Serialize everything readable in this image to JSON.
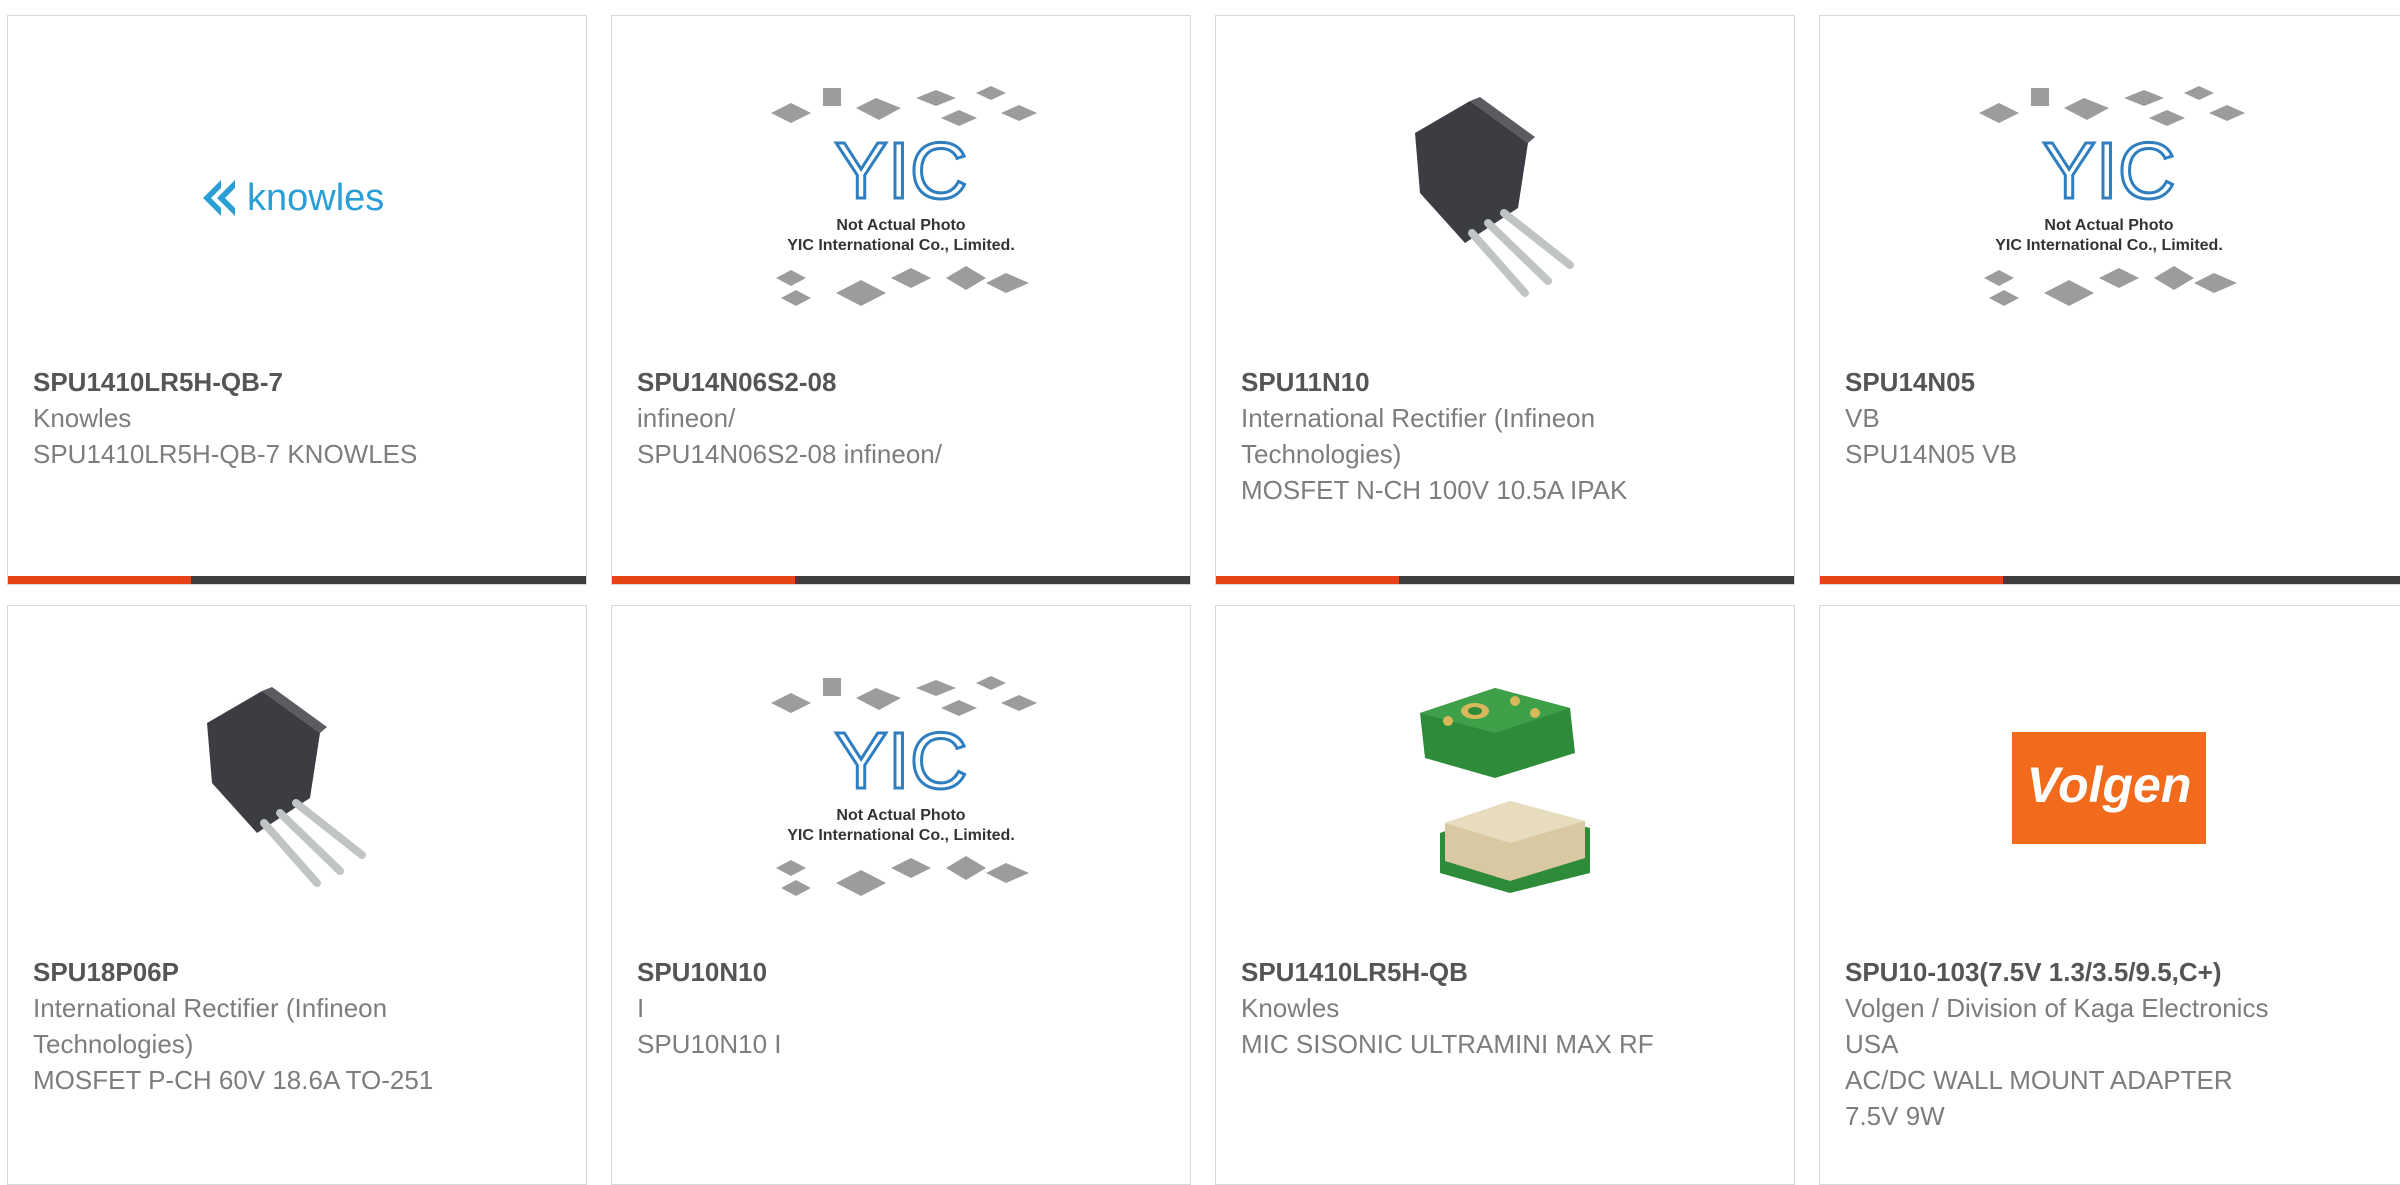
{
  "products": [
    {
      "part_number": "SPU1410LR5H-QB-7",
      "manufacturer": "Knowles",
      "description": "SPU1410LR5H-QB-7 KNOWLES",
      "image_icon": "knowles-logo",
      "logo_text": "knowles"
    },
    {
      "part_number": "SPU14N06S2-08",
      "manufacturer": "infineon/",
      "description": "SPU14N06S2-08 infineon/",
      "image_icon": "yic-placeholder",
      "placeholder_line1": "Not Actual Photo",
      "placeholder_line2": "YIC International Co., Limited."
    },
    {
      "part_number": "SPU11N10",
      "manufacturer": "International Rectifier (Infineon Technologies)",
      "description": "MOSFET N-CH 100V 10.5A IPAK",
      "image_icon": "transistor-ipak"
    },
    {
      "part_number": "SPU14N05",
      "manufacturer": "VB",
      "description": "SPU14N05 VB",
      "image_icon": "yic-placeholder",
      "placeholder_line1": "Not Actual Photo",
      "placeholder_line2": "YIC International Co., Limited."
    },
    {
      "part_number": "SPU18P06P",
      "manufacturer": "International Rectifier (Infineon Technologies)",
      "description": "MOSFET P-CH 60V 18.6A TO-251",
      "image_icon": "transistor-ipak"
    },
    {
      "part_number": "SPU10N10",
      "manufacturer": "I",
      "description": "SPU10N10 I",
      "image_icon": "yic-placeholder",
      "placeholder_line1": "Not Actual Photo",
      "placeholder_line2": "YIC International Co., Limited."
    },
    {
      "part_number": "SPU1410LR5H-QB",
      "manufacturer": "Knowles",
      "description": "MIC SISONIC ULTRAMINI MAX RF",
      "image_icon": "mems-microphone"
    },
    {
      "part_number": "SPU10-103(7.5V 1.3/3.5/9.5,C+)",
      "manufacturer": "Volgen / Division of Kaga Electronics USA",
      "description": "AC/DC WALL MOUNT ADAPTER 7.5V 9W",
      "image_icon": "volgen-logo",
      "logo_text": "Volgen"
    }
  ],
  "colors": {
    "accent": "#e84312",
    "bar": "#3e3e3e",
    "knowles": "#2a9fd6",
    "yic_blue": "#2f7fc0",
    "volgen": "#f26b1d"
  }
}
